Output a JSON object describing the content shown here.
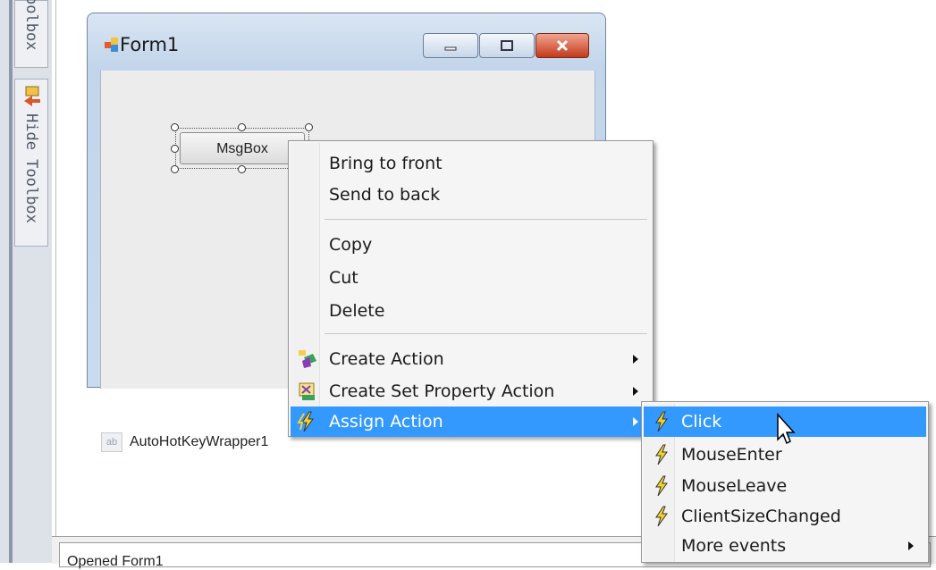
{
  "toolbox": {
    "tab_label": "oolbox",
    "hide_label": "Hide Toolbox"
  },
  "form": {
    "title": "Form1",
    "msgbox_button_label": "MsgBox"
  },
  "tray": {
    "icon_text": "ab",
    "component_label": "AutoHotKeyWrapper1"
  },
  "status": {
    "text": "Opened Form1"
  },
  "context_menu": {
    "items": [
      {
        "label": "Bring to front"
      },
      {
        "label": "Send to back"
      },
      {
        "label": "Copy"
      },
      {
        "label": "Cut"
      },
      {
        "label": "Delete"
      },
      {
        "label": "Create Action",
        "icon": "create-action-icon",
        "submenu": true
      },
      {
        "label": "Create Set Property Action",
        "icon": "set-property-icon",
        "submenu": true
      },
      {
        "label": "Assign Action",
        "icon": "lightning-icon",
        "submenu": true,
        "highlighted": true
      }
    ]
  },
  "submenu": {
    "items": [
      {
        "label": "Click",
        "icon": "lightning-icon",
        "highlighted": true
      },
      {
        "label": "MouseEnter",
        "icon": "lightning-icon"
      },
      {
        "label": "MouseLeave",
        "icon": "lightning-icon"
      },
      {
        "label": "ClientSizeChanged",
        "icon": "lightning-icon"
      },
      {
        "label": "More events",
        "submenu": true
      }
    ]
  },
  "colors": {
    "highlight": "#3399ff",
    "menu_bg": "#f5f5f5",
    "close_button": "#c43a1c"
  }
}
